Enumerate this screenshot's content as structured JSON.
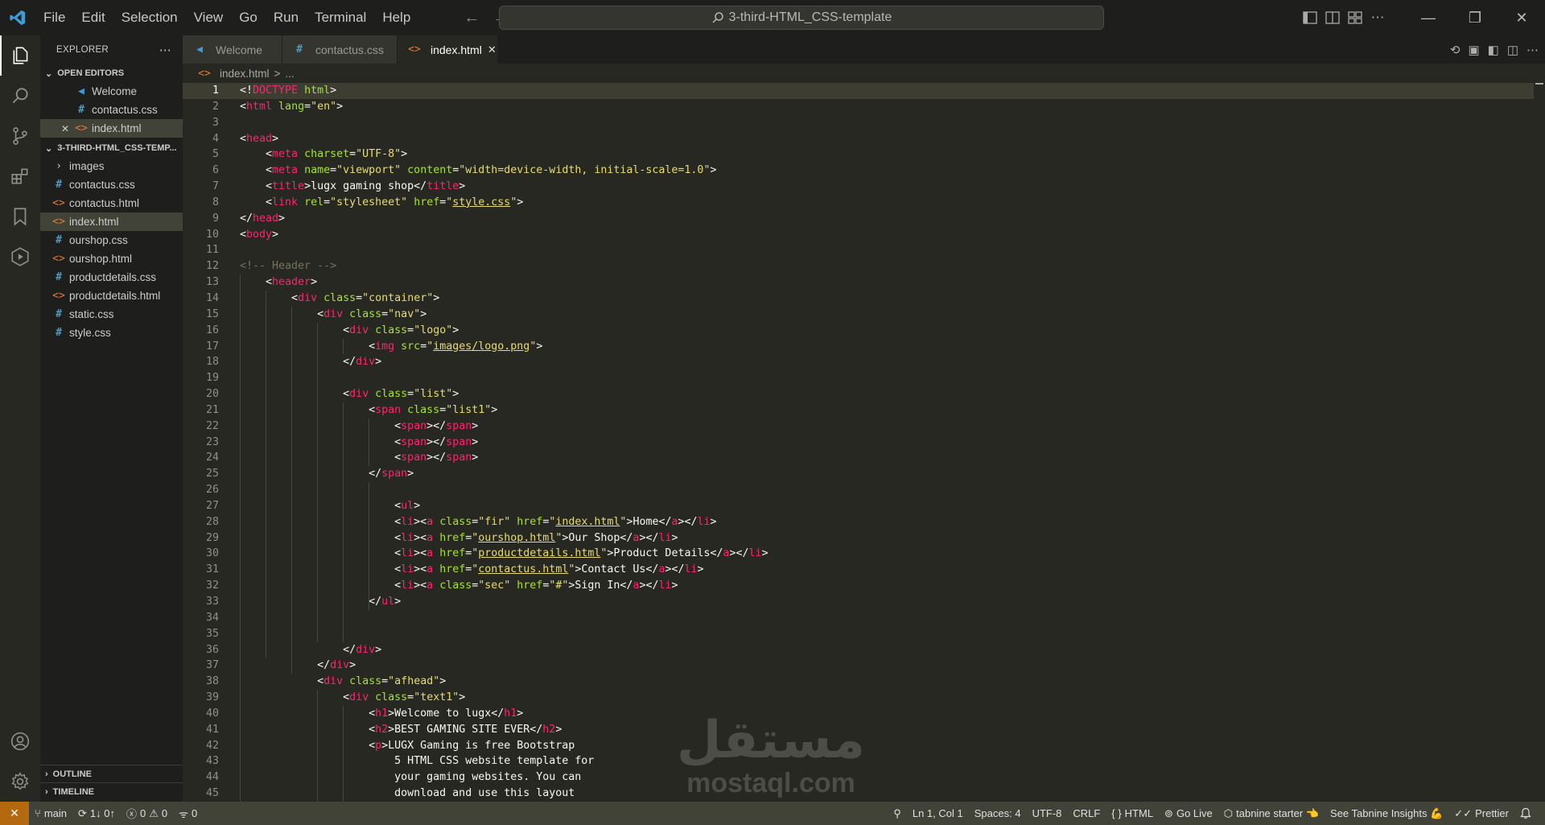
{
  "menu": [
    "File",
    "Edit",
    "Selection",
    "View",
    "Go",
    "Run",
    "Terminal",
    "Help"
  ],
  "command_center": "3-third-HTML_CSS-template",
  "sidebar": {
    "title": "EXPLORER",
    "open_editors_label": "OPEN EDITORS",
    "open_editors": [
      {
        "name": "Welcome",
        "icon": "vscode-icon"
      },
      {
        "name": "contactus.css",
        "icon": "#"
      },
      {
        "name": "index.html",
        "icon": "<>",
        "close": "✕"
      }
    ],
    "project_label": "3-THIRD-HTML_CSS-TEMP...",
    "files": [
      {
        "name": "images",
        "icon": "›"
      },
      {
        "name": "contactus.css",
        "icon": "#"
      },
      {
        "name": "contactus.html",
        "icon": "<>"
      },
      {
        "name": "index.html",
        "icon": "<>"
      },
      {
        "name": "ourshop.css",
        "icon": "#"
      },
      {
        "name": "ourshop.html",
        "icon": "<>"
      },
      {
        "name": "productdetails.css",
        "icon": "#"
      },
      {
        "name": "productdetails.html",
        "icon": "<>"
      },
      {
        "name": "static.css",
        "icon": "#"
      },
      {
        "name": "style.css",
        "icon": "#"
      }
    ],
    "outline_label": "OUTLINE",
    "timeline_label": "TIMELINE"
  },
  "tabs": [
    {
      "label": "Welcome",
      "icon": "vscode-icon"
    },
    {
      "label": "contactus.css",
      "icon": "#"
    },
    {
      "label": "index.html",
      "icon": "<>",
      "close": "✕"
    }
  ],
  "breadcrumb": {
    "file": "index.html",
    "sep": ">",
    "rest": "..."
  },
  "code_lines": [
    [
      [
        "p",
        "<!"
      ],
      [
        "t",
        "DOCTYPE"
      ],
      [
        "a",
        " html"
      ],
      [
        "p",
        ">"
      ]
    ],
    [
      [
        "p",
        "<"
      ],
      [
        "t",
        "html"
      ],
      [
        "a",
        " lang"
      ],
      [
        "p",
        "="
      ],
      [
        "s",
        "\"en\""
      ],
      [
        "p",
        ">"
      ]
    ],
    [],
    [
      [
        "p",
        "<"
      ],
      [
        "t",
        "head"
      ],
      [
        "p",
        ">"
      ]
    ],
    [
      [
        "p",
        "    <"
      ],
      [
        "t",
        "meta"
      ],
      [
        "a",
        " charset"
      ],
      [
        "p",
        "="
      ],
      [
        "s",
        "\"UTF-8\""
      ],
      [
        "p",
        ">"
      ]
    ],
    [
      [
        "p",
        "    <"
      ],
      [
        "t",
        "meta"
      ],
      [
        "a",
        " name"
      ],
      [
        "p",
        "="
      ],
      [
        "s",
        "\"viewport\""
      ],
      [
        "a",
        " content"
      ],
      [
        "p",
        "="
      ],
      [
        "s",
        "\"width=device-width, initial-scale=1.0\""
      ],
      [
        "p",
        ">"
      ]
    ],
    [
      [
        "p",
        "    <"
      ],
      [
        "t",
        "title"
      ],
      [
        "p",
        ">"
      ],
      [
        "x",
        "lugx gaming shop"
      ],
      [
        "p",
        "</"
      ],
      [
        "t",
        "title"
      ],
      [
        "p",
        ">"
      ]
    ],
    [
      [
        "p",
        "    <"
      ],
      [
        "t",
        "link"
      ],
      [
        "a",
        " rel"
      ],
      [
        "p",
        "="
      ],
      [
        "s",
        "\"stylesheet\""
      ],
      [
        "a",
        " href"
      ],
      [
        "p",
        "="
      ],
      [
        "s",
        "\""
      ],
      [
        "l",
        "style.css"
      ],
      [
        "s",
        "\""
      ],
      [
        "p",
        ">"
      ]
    ],
    [
      [
        "p",
        "</"
      ],
      [
        "t",
        "head"
      ],
      [
        "p",
        ">"
      ]
    ],
    [
      [
        "p",
        "<"
      ],
      [
        "t",
        "body"
      ],
      [
        "p",
        ">"
      ]
    ],
    [],
    [
      [
        "c",
        "<!-- Header -->"
      ]
    ],
    [
      [
        "p",
        "    <"
      ],
      [
        "t",
        "header"
      ],
      [
        "p",
        ">"
      ]
    ],
    [
      [
        "p",
        "        <"
      ],
      [
        "t",
        "div"
      ],
      [
        "a",
        " class"
      ],
      [
        "p",
        "="
      ],
      [
        "s",
        "\"container\""
      ],
      [
        "p",
        ">"
      ]
    ],
    [
      [
        "p",
        "            <"
      ],
      [
        "t",
        "div"
      ],
      [
        "a",
        " class"
      ],
      [
        "p",
        "="
      ],
      [
        "s",
        "\"nav\""
      ],
      [
        "p",
        ">"
      ]
    ],
    [
      [
        "p",
        "                <"
      ],
      [
        "t",
        "div"
      ],
      [
        "a",
        " class"
      ],
      [
        "p",
        "="
      ],
      [
        "s",
        "\"logo\""
      ],
      [
        "p",
        ">"
      ]
    ],
    [
      [
        "p",
        "                    <"
      ],
      [
        "t",
        "img"
      ],
      [
        "a",
        " src"
      ],
      [
        "p",
        "="
      ],
      [
        "s",
        "\""
      ],
      [
        "l",
        "images/logo.png"
      ],
      [
        "s",
        "\""
      ],
      [
        "p",
        ">"
      ]
    ],
    [
      [
        "p",
        "                </"
      ],
      [
        "t",
        "div"
      ],
      [
        "p",
        ">"
      ]
    ],
    [],
    [
      [
        "p",
        "                <"
      ],
      [
        "t",
        "div"
      ],
      [
        "a",
        " class"
      ],
      [
        "p",
        "="
      ],
      [
        "s",
        "\"list\""
      ],
      [
        "p",
        ">"
      ]
    ],
    [
      [
        "p",
        "                    <"
      ],
      [
        "t",
        "span"
      ],
      [
        "a",
        " class"
      ],
      [
        "p",
        "="
      ],
      [
        "s",
        "\"list1\""
      ],
      [
        "p",
        ">"
      ]
    ],
    [
      [
        "p",
        "                        <"
      ],
      [
        "t",
        "span"
      ],
      [
        "p",
        "></"
      ],
      [
        "t",
        "span"
      ],
      [
        "p",
        ">"
      ]
    ],
    [
      [
        "p",
        "                        <"
      ],
      [
        "t",
        "span"
      ],
      [
        "p",
        "></"
      ],
      [
        "t",
        "span"
      ],
      [
        "p",
        ">"
      ]
    ],
    [
      [
        "p",
        "                        <"
      ],
      [
        "t",
        "span"
      ],
      [
        "p",
        "></"
      ],
      [
        "t",
        "span"
      ],
      [
        "p",
        ">"
      ]
    ],
    [
      [
        "p",
        "                    </"
      ],
      [
        "t",
        "span"
      ],
      [
        "p",
        ">"
      ]
    ],
    [],
    [
      [
        "p",
        "                        <"
      ],
      [
        "t",
        "ul"
      ],
      [
        "p",
        ">"
      ]
    ],
    [
      [
        "p",
        "                        <"
      ],
      [
        "t",
        "li"
      ],
      [
        "p",
        "><"
      ],
      [
        "t",
        "a"
      ],
      [
        "a",
        " class"
      ],
      [
        "p",
        "="
      ],
      [
        "s",
        "\"fir\""
      ],
      [
        "a",
        " href"
      ],
      [
        "p",
        "="
      ],
      [
        "s",
        "\""
      ],
      [
        "l",
        "index.html"
      ],
      [
        "s",
        "\""
      ],
      [
        "p",
        ">"
      ],
      [
        "x",
        "Home"
      ],
      [
        "p",
        "</"
      ],
      [
        "t",
        "a"
      ],
      [
        "p",
        "></"
      ],
      [
        "t",
        "li"
      ],
      [
        "p",
        ">"
      ]
    ],
    [
      [
        "p",
        "                        <"
      ],
      [
        "t",
        "li"
      ],
      [
        "p",
        "><"
      ],
      [
        "t",
        "a"
      ],
      [
        "a",
        " href"
      ],
      [
        "p",
        "="
      ],
      [
        "s",
        "\""
      ],
      [
        "l",
        "ourshop.html"
      ],
      [
        "s",
        "\""
      ],
      [
        "p",
        ">"
      ],
      [
        "x",
        "Our Shop"
      ],
      [
        "p",
        "</"
      ],
      [
        "t",
        "a"
      ],
      [
        "p",
        "></"
      ],
      [
        "t",
        "li"
      ],
      [
        "p",
        ">"
      ]
    ],
    [
      [
        "p",
        "                        <"
      ],
      [
        "t",
        "li"
      ],
      [
        "p",
        "><"
      ],
      [
        "t",
        "a"
      ],
      [
        "a",
        " href"
      ],
      [
        "p",
        "="
      ],
      [
        "s",
        "\""
      ],
      [
        "l",
        "productdetails.html"
      ],
      [
        "s",
        "\""
      ],
      [
        "p",
        ">"
      ],
      [
        "x",
        "Product Details"
      ],
      [
        "p",
        "</"
      ],
      [
        "t",
        "a"
      ],
      [
        "p",
        "></"
      ],
      [
        "t",
        "li"
      ],
      [
        "p",
        ">"
      ]
    ],
    [
      [
        "p",
        "                        <"
      ],
      [
        "t",
        "li"
      ],
      [
        "p",
        "><"
      ],
      [
        "t",
        "a"
      ],
      [
        "a",
        " href"
      ],
      [
        "p",
        "="
      ],
      [
        "s",
        "\""
      ],
      [
        "l",
        "contactus.html"
      ],
      [
        "s",
        "\""
      ],
      [
        "p",
        ">"
      ],
      [
        "x",
        "Contact Us"
      ],
      [
        "p",
        "</"
      ],
      [
        "t",
        "a"
      ],
      [
        "p",
        "></"
      ],
      [
        "t",
        "li"
      ],
      [
        "p",
        ">"
      ]
    ],
    [
      [
        "p",
        "                        <"
      ],
      [
        "t",
        "li"
      ],
      [
        "p",
        "><"
      ],
      [
        "t",
        "a"
      ],
      [
        "a",
        " class"
      ],
      [
        "p",
        "="
      ],
      [
        "s",
        "\"sec\""
      ],
      [
        "a",
        " href"
      ],
      [
        "p",
        "="
      ],
      [
        "s",
        "\"#\""
      ],
      [
        "p",
        ">"
      ],
      [
        "x",
        "Sign In"
      ],
      [
        "p",
        "</"
      ],
      [
        "t",
        "a"
      ],
      [
        "p",
        "></"
      ],
      [
        "t",
        "li"
      ],
      [
        "p",
        ">"
      ]
    ],
    [
      [
        "p",
        "                    </"
      ],
      [
        "t",
        "ul"
      ],
      [
        "p",
        ">"
      ]
    ],
    [],
    [],
    [
      [
        "p",
        "                </"
      ],
      [
        "t",
        "div"
      ],
      [
        "p",
        ">"
      ]
    ],
    [
      [
        "p",
        "            </"
      ],
      [
        "t",
        "div"
      ],
      [
        "p",
        ">"
      ]
    ],
    [
      [
        "p",
        "            <"
      ],
      [
        "t",
        "div"
      ],
      [
        "a",
        " class"
      ],
      [
        "p",
        "="
      ],
      [
        "s",
        "\"afhead\""
      ],
      [
        "p",
        ">"
      ]
    ],
    [
      [
        "p",
        "                <"
      ],
      [
        "t",
        "div"
      ],
      [
        "a",
        " class"
      ],
      [
        "p",
        "="
      ],
      [
        "s",
        "\"text1\""
      ],
      [
        "p",
        ">"
      ]
    ],
    [
      [
        "p",
        "                    <"
      ],
      [
        "t",
        "h1"
      ],
      [
        "p",
        ">"
      ],
      [
        "x",
        "Welcome to lugx"
      ],
      [
        "p",
        "</"
      ],
      [
        "t",
        "h1"
      ],
      [
        "p",
        ">"
      ]
    ],
    [
      [
        "p",
        "                    <"
      ],
      [
        "t",
        "h2"
      ],
      [
        "p",
        ">"
      ],
      [
        "x",
        "BEST GAMING SITE EVER"
      ],
      [
        "p",
        "</"
      ],
      [
        "t",
        "h2"
      ],
      [
        "p",
        ">"
      ]
    ],
    [
      [
        "p",
        "                    <"
      ],
      [
        "t",
        "p"
      ],
      [
        "p",
        ">"
      ],
      [
        "x",
        "LUGX Gaming is free Bootstrap"
      ]
    ],
    [
      [
        "x",
        "                        5 HTML CSS website template for"
      ]
    ],
    [
      [
        "x",
        "                        your gaming websites. You can"
      ]
    ],
    [
      [
        "x",
        "                        download and use this layout"
      ]
    ]
  ],
  "guides": [
    {
      "from": 13,
      "to": 45,
      "col": 0
    },
    {
      "from": 14,
      "to": 36,
      "col": 4
    },
    {
      "from": 15,
      "to": 37,
      "col": 8
    },
    {
      "from": 16,
      "to": 35,
      "col": 12
    },
    {
      "from": 39,
      "to": 45,
      "col": 12
    },
    {
      "from": 17,
      "to": 17,
      "col": 16
    },
    {
      "from": 21,
      "to": 35,
      "col": 16
    },
    {
      "from": 40,
      "to": 45,
      "col": 16
    },
    {
      "from": 22,
      "to": 24,
      "col": 20
    },
    {
      "from": 26,
      "to": 33,
      "col": 20
    },
    {
      "from": 28,
      "to": 32,
      "col": 20
    }
  ],
  "watermark": {
    "arabic": "مستقل",
    "latin": "mostaql.com"
  },
  "status": {
    "branch": "main",
    "sync": "1↓ 0↑",
    "errors": "0",
    "warnings": "0",
    "ports": "0",
    "position": "Ln 1, Col 1",
    "spaces": "Spaces: 4",
    "encoding": "UTF-8",
    "eol": "CRLF",
    "language": "HTML",
    "golive": "Go Live",
    "tabnine": "tabnine starter 👈",
    "tabnine_insights": "See Tabnine Insights 💪",
    "prettier": "Prettier"
  }
}
